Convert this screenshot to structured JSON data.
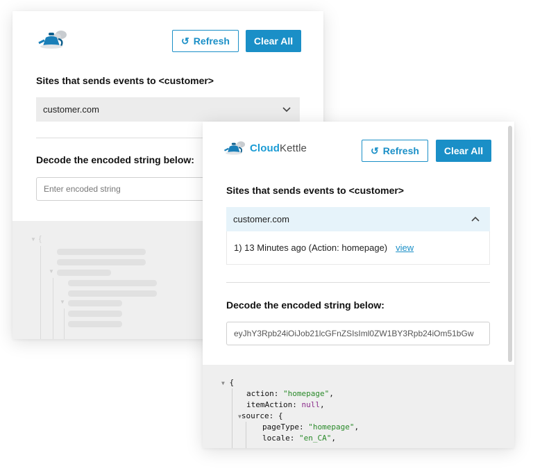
{
  "brand": {
    "name_part1": "Cloud",
    "name_part2": "Kettle",
    "primary_color": "#1a8fc7",
    "logo_icon": "kettle-cloud-icon"
  },
  "toolbar": {
    "refresh_label": "Refresh",
    "clear_all_label": "Clear All",
    "refresh_icon": "refresh-icon"
  },
  "sites": {
    "heading": "Sites that sends events to <customer>",
    "selected_site": "customer.com"
  },
  "events": [
    {
      "text": "1) 13  Minutes ago (Action: homepage)",
      "link_label": "view"
    }
  ],
  "decode": {
    "heading": "Decode the encoded string below:",
    "placeholder": "Enter encoded string",
    "value": "eyJhY3Rpb24iOiJob21lcGFnZSIsIml0ZW1BY3Rpb24iOm51bGw"
  },
  "json_view": {
    "open_brace": "{",
    "lines": [
      {
        "key": "action",
        "value": "\"homepage\"",
        "type": "string"
      },
      {
        "key": "itemAction",
        "value": "null",
        "type": "null"
      },
      {
        "key": "source",
        "value": "{",
        "type": "object"
      },
      {
        "key": "pageType",
        "value": "\"homepage\"",
        "type": "string"
      },
      {
        "key": "locale",
        "value": "\"en_CA\"",
        "type": "string"
      }
    ]
  }
}
